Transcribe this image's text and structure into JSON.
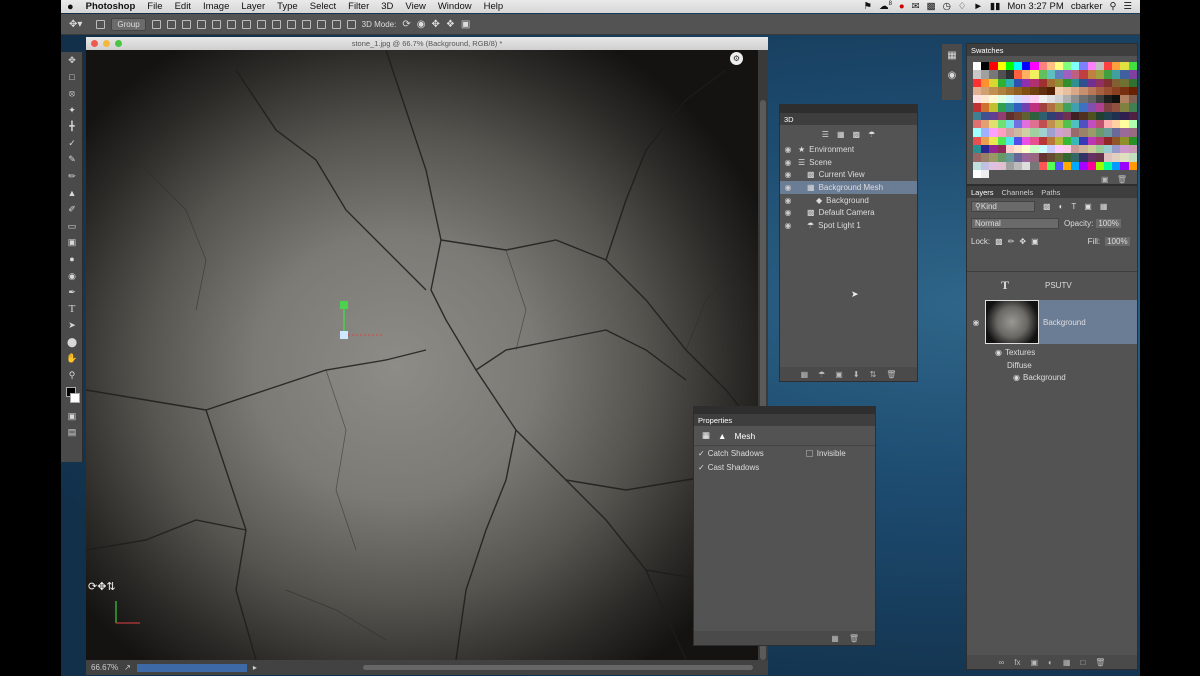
{
  "menubar": {
    "apple": "",
    "app": "Photoshop",
    "items": [
      "File",
      "Edit",
      "Image",
      "Layer",
      "Type",
      "Select",
      "Filter",
      "3D",
      "View",
      "Window",
      "Help"
    ],
    "badge": "8",
    "time": "Mon 3:27 PM",
    "user": "cbarker"
  },
  "options_bar": {
    "auto_select": "Group",
    "mode_label": "3D Mode:"
  },
  "tools": [
    "move-tool",
    "marquee-tool",
    "lasso-tool",
    "quick-select-tool",
    "crop-tool",
    "eyedropper-tool",
    "healing-tool",
    "brush-tool",
    "stamp-tool",
    "history-brush-tool",
    "eraser-tool",
    "gradient-tool",
    "blur-tool",
    "dodge-tool",
    "pen-tool",
    "type-tool",
    "path-select-tool",
    "shape-tool",
    "hand-tool",
    "zoom-tool"
  ],
  "document": {
    "title": "stone_1.jpg @ 66.7% (Background, RGB/8) *",
    "zoom": "66.67%"
  },
  "panel_3d": {
    "title": "3D",
    "items": [
      {
        "label": "Environment",
        "indent": 0,
        "selected": false
      },
      {
        "label": "Scene",
        "indent": 0,
        "selected": false
      },
      {
        "label": "Current View",
        "indent": 1,
        "selected": false
      },
      {
        "label": "Background Mesh",
        "indent": 1,
        "selected": true
      },
      {
        "label": "Background",
        "indent": 2,
        "selected": false
      },
      {
        "label": "Default Camera",
        "indent": 1,
        "selected": false
      },
      {
        "label": "Spot Light 1",
        "indent": 1,
        "selected": false
      }
    ]
  },
  "properties": {
    "title": "Properties",
    "section": "Mesh",
    "catch_shadows": "Catch Shadows",
    "invisible": "Invisible",
    "cast_shadows": "Cast Shadows"
  },
  "swatches": {
    "title": "Swatches",
    "colors": [
      "#ffffff",
      "#000000",
      "#ff0000",
      "#ffff00",
      "#00ff00",
      "#00ffff",
      "#0000ff",
      "#ff00ff",
      "#ff8080",
      "#ffc080",
      "#ffff80",
      "#80ff80",
      "#80ffff",
      "#8080ff",
      "#ff80ff",
      "#c0c0c0",
      "#ff4040",
      "#ffa040",
      "#e0e040",
      "#40e040",
      "#c8c8c8",
      "#a0a0a0",
      "#787878",
      "#505050",
      "#303030",
      "#ff6040",
      "#ffb060",
      "#f0f060",
      "#60c060",
      "#60c0c0",
      "#6080c0",
      "#a060c0",
      "#c06080",
      "#c04040",
      "#c08040",
      "#a0a040",
      "#40a040",
      "#40a0a0",
      "#4060a0",
      "#8040a0",
      "#ff3030",
      "#ff9030",
      "#d8d830",
      "#30b030",
      "#30b0b0",
      "#3050b0",
      "#9030b0",
      "#b03070",
      "#a03030",
      "#a07030",
      "#909030",
      "#309030",
      "#309090",
      "#305090",
      "#703090",
      "#903060",
      "#803030",
      "#806030",
      "#707030",
      "#307030",
      "#e0b090",
      "#d0a070",
      "#c09050",
      "#b08040",
      "#a07030",
      "#906020",
      "#805010",
      "#704010",
      "#603010",
      "#502000",
      "#f0d0b0",
      "#e8c0a0",
      "#d8a888",
      "#c89070",
      "#b87858",
      "#a86040",
      "#985030",
      "#884020",
      "#783010",
      "#682000",
      "#ffe0e0",
      "#ffe8d0",
      "#fff8d0",
      "#e0ffe0",
      "#d0f8ff",
      "#d0e0ff",
      "#e8d0ff",
      "#ffd0f0",
      "#f0f0f0",
      "#e0e0e0",
      "#d0d0d0",
      "#b0b0b0",
      "#909090",
      "#707070",
      "#606060",
      "#404040",
      "#202020",
      "#101010",
      "#b08060",
      "#806050",
      "#c03030",
      "#d07030",
      "#c0c030",
      "#30a050",
      "#3090a0",
      "#3060c0",
      "#7040b0",
      "#c03080",
      "#a04040",
      "#b07040",
      "#a0a040",
      "#40a060",
      "#40a0b0",
      "#4070c0",
      "#8050b0",
      "#b04090",
      "#804040",
      "#905040",
      "#808040",
      "#408050",
      "#408090",
      "#405090",
      "#604090",
      "#904070",
      "#603030",
      "#704030",
      "#606030",
      "#306040",
      "#306070",
      "#304070",
      "#503070",
      "#703050",
      "#402020",
      "#503020",
      "#505020",
      "#204030",
      "#204050",
      "#203050",
      "#302050",
      "#502040",
      "#e07070",
      "#e0a070",
      "#e0e070",
      "#70e070",
      "#70e0e0",
      "#7070e0",
      "#e070e0",
      "#e07090",
      "#c05050",
      "#c09050",
      "#c0c050",
      "#50c050",
      "#50c0c0",
      "#5050c0",
      "#c050c0",
      "#c05070",
      "#ffb0b0",
      "#ffd0a0",
      "#ffffa0",
      "#b0ffb0",
      "#a0ffff",
      "#a0b0ff",
      "#ffa0ff",
      "#ffa0c0",
      "#d0a0a0",
      "#d0b8a0",
      "#d0d0a0",
      "#a0d0a0",
      "#a0d0d0",
      "#a0a0d0",
      "#d0a0d0",
      "#d0a0b8",
      "#9a6a6a",
      "#9a826a",
      "#9a9a6a",
      "#6a9a6a",
      "#6a9a9a",
      "#6a6a9a",
      "#9a6a9a",
      "#9a6a82",
      "#e85050",
      "#e8a050",
      "#e8e850",
      "#50e850",
      "#50e8e8",
      "#5050e8",
      "#e850e8",
      "#e85090",
      "#b83838",
      "#b87838",
      "#b8b838",
      "#38b838",
      "#38b8b8",
      "#3838b8",
      "#b838b8",
      "#b83870",
      "#902828",
      "#905828",
      "#909028",
      "#289028",
      "#289090",
      "#282890",
      "#902890",
      "#902858",
      "#ffcccc",
      "#ffe5cc",
      "#ffffcc",
      "#ccffcc",
      "#ccffff",
      "#ccccff",
      "#ffccff",
      "#ffcce5",
      "#cc9999",
      "#ccb299",
      "#cccc99",
      "#99cc99",
      "#99cccc",
      "#9999cc",
      "#cc99cc",
      "#cc99b2",
      "#996666",
      "#997f66",
      "#999966",
      "#669966",
      "#669999",
      "#666699",
      "#996699",
      "#99667f",
      "#663333",
      "#664c33",
      "#666633",
      "#336633",
      "#336666",
      "#333366",
      "#663366",
      "#66334c",
      "#e0c0c0",
      "#e0d0c0",
      "#e0e0c0",
      "#c0e0c0",
      "#c0e0e0",
      "#c0c0e0",
      "#e0c0e0",
      "#e0c0d0",
      "#a0a0a0",
      "#bbbbbb",
      "#dddddd",
      "#777777",
      "#ff5555",
      "#55ff55",
      "#5555ff",
      "#ffaa00",
      "#00aaff",
      "#aa00ff",
      "#ff0099",
      "#99ff00",
      "#00ff99",
      "#0099ff",
      "#9900ff",
      "#ff9900",
      "#ffffff",
      "#eeeeee"
    ]
  },
  "layers_panel": {
    "tabs": [
      "Layers",
      "Channels",
      "Paths"
    ],
    "filter_kind": "Kind",
    "blend_mode": "Normal",
    "opacity_label": "Opacity:",
    "opacity": "100%",
    "lock_label": "Lock:",
    "fill_label": "Fill:",
    "fill": "100%",
    "layers": [
      {
        "name": "PSUTV",
        "type": "text"
      },
      {
        "name": "Background",
        "type": "3d",
        "selected": true
      }
    ],
    "sub": {
      "textures": "Textures",
      "diffuse": "Diffuse",
      "diffuse_item": "Background"
    }
  }
}
